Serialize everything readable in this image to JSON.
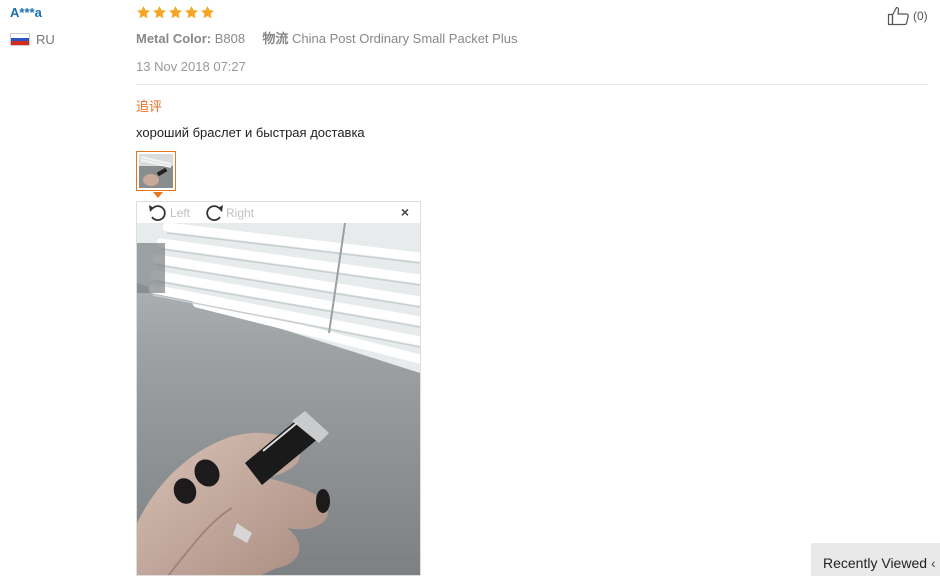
{
  "review": {
    "user_name": "A***a",
    "country": "RU",
    "rating": 5,
    "metal_color_label": "Metal Color:",
    "metal_color_value": "B808",
    "shipping_label": "物流",
    "shipping_value": "China Post Ordinary Small Packet Plus",
    "date": "13 Nov 2018 07:27",
    "likes": "(0)",
    "append_label": "追评",
    "feedback_text": "хороший браслет и быстрая доставка"
  },
  "viewer": {
    "rotate_left_label": "Left",
    "rotate_right_label": "Right",
    "close_label": "×"
  },
  "recently_viewed": {
    "label": "Recently Viewed"
  },
  "colors": {
    "star": "#f5a623",
    "accent": "#e8761d",
    "username": "#1a6fb3"
  },
  "icons": {
    "flag": "russia-flag-icon",
    "like": "thumbs-up-icon",
    "rotate_left": "rotate-left-icon",
    "rotate_right": "rotate-right-icon",
    "close": "close-icon"
  }
}
